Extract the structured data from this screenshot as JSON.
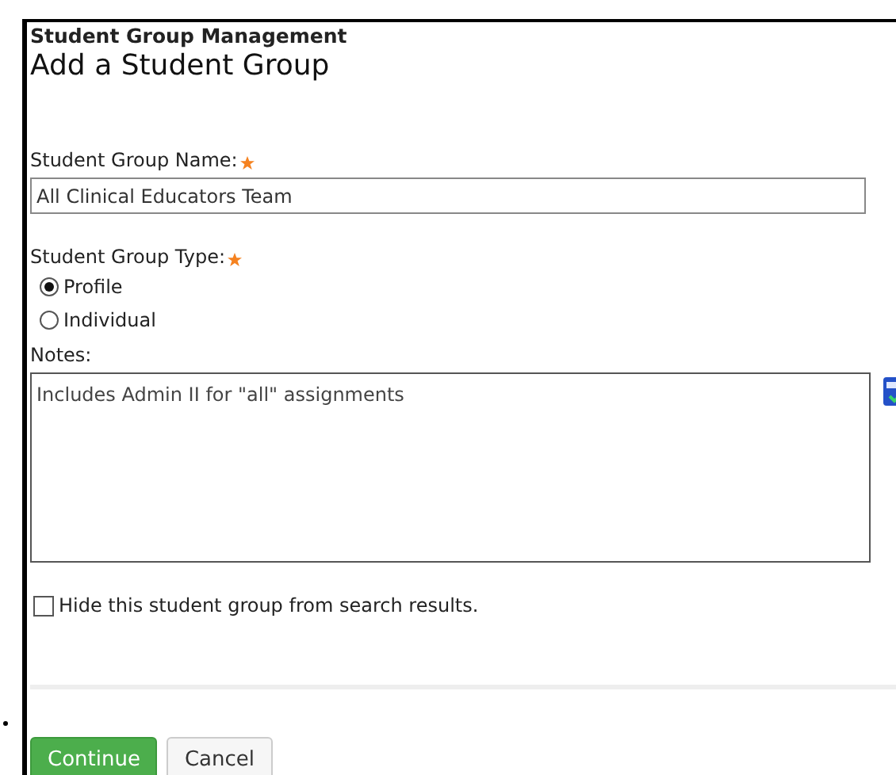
{
  "breadcrumb": "Student Group Management",
  "title": "Add a Student Group",
  "name_field": {
    "label": "Student Group Name:",
    "required": true,
    "value": "All Clinical Educators Team"
  },
  "type_field": {
    "label": "Student Group Type:",
    "required": true,
    "options": [
      {
        "label": "Profile",
        "selected": true
      },
      {
        "label": "Individual",
        "selected": false
      }
    ]
  },
  "notes_field": {
    "label": "Notes:",
    "value": "Includes Admin II for \"all\" assignments"
  },
  "hide_option": {
    "label": "Hide this student group from search results.",
    "checked": false
  },
  "buttons": [
    {
      "label": "Continue",
      "kind": "primary"
    },
    {
      "label": "Cancel",
      "kind": "secondary"
    }
  ]
}
